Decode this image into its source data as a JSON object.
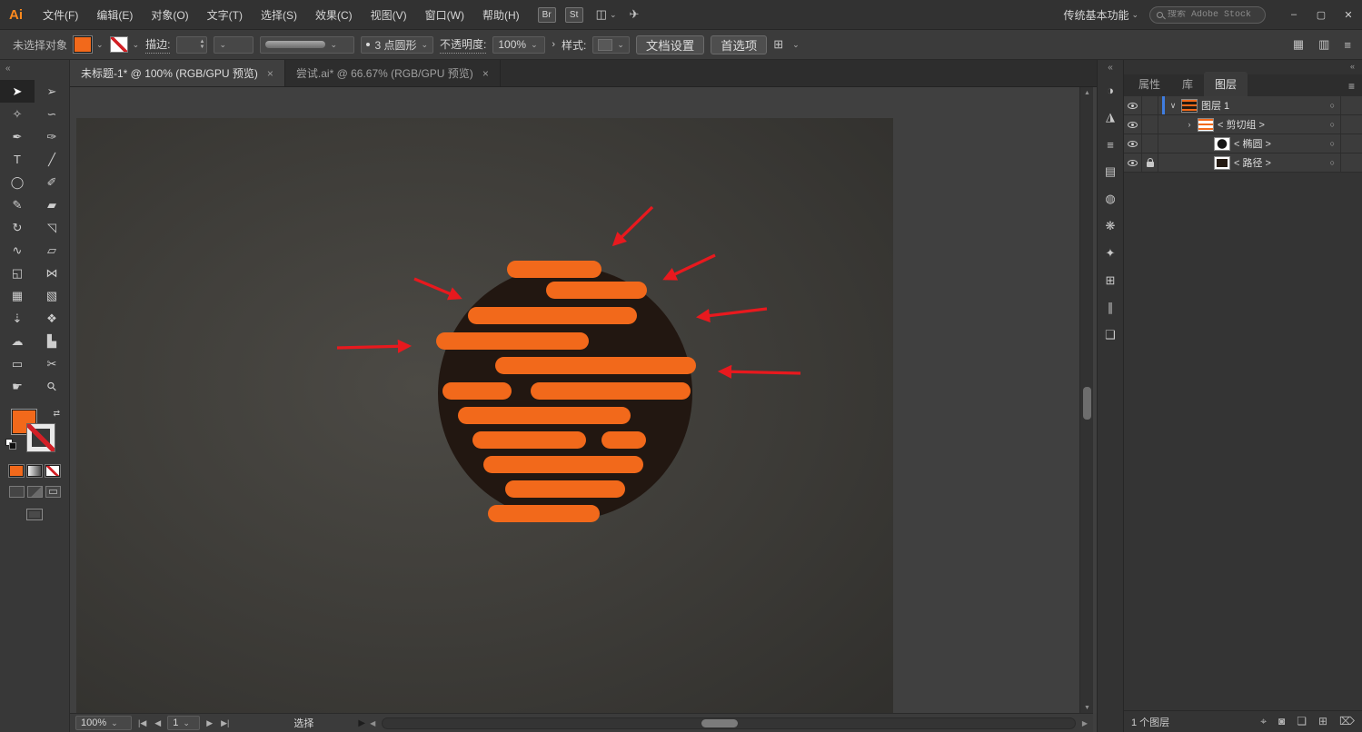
{
  "colors": {
    "accent": "#ff8a1e",
    "stripe": "#f2691b",
    "arrow": "#e8191e",
    "circleFill": "#221711",
    "layerblue": "#3f7de0"
  },
  "titlebar": {
    "logo": "Ai",
    "menus": [
      "文件(F)",
      "编辑(E)",
      "对象(O)",
      "文字(T)",
      "选择(S)",
      "效果(C)",
      "视图(V)",
      "窗口(W)",
      "帮助(H)"
    ],
    "bridge_button": "Br",
    "stock_button": "St",
    "layout_icon": "◫",
    "share_icon": "✈",
    "workspace_switcher": "传统基本功能",
    "search_placeholder": "搜索 Adobe Stock",
    "minimize": "–",
    "maximize": "▢",
    "close": "✕"
  },
  "controlbar": {
    "no_selection_label": "未选择对象",
    "stroke_label": "描边:",
    "brush_name": "3 点圆形",
    "opacity_label": "不透明度:",
    "opacity_value": "100%",
    "opacity_disclose": "›",
    "style_label": "样式:",
    "document_setup_button": "文档设置",
    "preferences_button": "首选项",
    "align_icon": "⊞",
    "arrange_icon": "▦",
    "docs_icon": "▥",
    "menu_icon": "≡"
  },
  "doc_tabs": [
    {
      "title": "未标题-1* @ 100% (RGB/GPU 预览)",
      "close": "×",
      "state": "active"
    },
    {
      "title": "尝试.ai* @ 66.67% (RGB/GPU 预览)",
      "close": "×",
      "state": "inactive"
    }
  ],
  "tools": [
    {
      "name": "selection-tool",
      "glyph": "➤",
      "state": "active"
    },
    {
      "name": "direct-selection-tool",
      "glyph": "➢",
      "state": "normal"
    },
    {
      "name": "magic-wand-tool",
      "glyph": "✧",
      "state": "normal"
    },
    {
      "name": "lasso-tool",
      "glyph": "∽",
      "state": "normal"
    },
    {
      "name": "pen-tool",
      "glyph": "✒",
      "state": "normal"
    },
    {
      "name": "curvature-tool",
      "glyph": "✑",
      "state": "normal"
    },
    {
      "name": "type-tool",
      "glyph": "T",
      "state": "normal"
    },
    {
      "name": "line-segment-tool",
      "glyph": "╱",
      "state": "normal"
    },
    {
      "name": "ellipse-tool",
      "glyph": "◯",
      "state": "normal"
    },
    {
      "name": "paintbrush-tool",
      "glyph": "✐",
      "state": "normal"
    },
    {
      "name": "shaper-tool",
      "glyph": "✎",
      "state": "normal"
    },
    {
      "name": "eraser-tool",
      "glyph": "▰",
      "state": "normal"
    },
    {
      "name": "rotate-tool",
      "glyph": "↻",
      "state": "normal"
    },
    {
      "name": "scale-tool",
      "glyph": "◹",
      "state": "normal"
    },
    {
      "name": "width-tool",
      "glyph": "∿",
      "state": "normal"
    },
    {
      "name": "free-transform-tool",
      "glyph": "▱",
      "state": "normal"
    },
    {
      "name": "shape-builder-tool",
      "glyph": "◱",
      "state": "normal"
    },
    {
      "name": "perspective-grid-tool",
      "glyph": "⋈",
      "state": "normal"
    },
    {
      "name": "mesh-tool",
      "glyph": "▦",
      "state": "normal"
    },
    {
      "name": "gradient-tool",
      "glyph": "▧",
      "state": "normal"
    },
    {
      "name": "eyedropper-tool",
      "glyph": "⇣",
      "state": "normal"
    },
    {
      "name": "blend-tool",
      "glyph": "❖",
      "state": "normal"
    },
    {
      "name": "symbol-sprayer-tool",
      "glyph": "☁",
      "state": "normal"
    },
    {
      "name": "column-graph-tool",
      "glyph": "▙",
      "state": "normal"
    },
    {
      "name": "artboard-tool",
      "glyph": "▭",
      "state": "normal"
    },
    {
      "name": "slice-tool",
      "glyph": "✂",
      "state": "normal"
    },
    {
      "name": "hand-tool",
      "glyph": "☛",
      "state": "normal"
    },
    {
      "name": "zoom-tool",
      "glyph": "⚲",
      "state": "normal"
    }
  ],
  "panel_strip": [
    {
      "name": "color-panel-icon",
      "glyph": "◑"
    },
    {
      "name": "color-guide-panel-icon",
      "glyph": "◮"
    },
    {
      "name": "stroke-panel-icon",
      "glyph": "≡"
    },
    {
      "name": "gradient-panel-icon",
      "glyph": "▤"
    },
    {
      "name": "transparency-panel-icon",
      "glyph": "◍"
    },
    {
      "name": "brushes-panel-icon",
      "glyph": "❋"
    },
    {
      "name": "symbols-panel-icon",
      "glyph": "✦"
    },
    {
      "name": "transform-panel-icon",
      "glyph": "⊞"
    },
    {
      "name": "align-panel-icon",
      "glyph": "∥"
    },
    {
      "name": "pathfinder-panel-icon",
      "glyph": "❑"
    }
  ],
  "dock": {
    "collapse_icon": "«",
    "panel_menu_icon": "≡",
    "tabs": [
      {
        "label": "属性",
        "state": "inactive"
      },
      {
        "label": "库",
        "state": "inactive"
      },
      {
        "label": "图层",
        "state": "active"
      }
    ],
    "layers": [
      {
        "name": "图层 1",
        "disclosure": "∨",
        "ind": "a",
        "thumb": "artwork",
        "locked": "false",
        "selected": "true"
      },
      {
        "name": "< 剪切组 >",
        "disclosure": "›",
        "ind": "b",
        "thumb": "clipgroup",
        "locked": "false",
        "selected": "false"
      },
      {
        "name": "< 椭圆 >",
        "disclosure": "",
        "ind": "c",
        "thumb": "ellipse",
        "locked": "false",
        "selected": "false"
      },
      {
        "name": "< 路径 >",
        "disclosure": "",
        "ind": "c",
        "thumb": "path",
        "locked": "true",
        "selected": "false"
      }
    ],
    "target_glyph": "○",
    "footer_count": "1 个图层",
    "footer_icons": [
      {
        "name": "locate-object-icon",
        "glyph": "⌖"
      },
      {
        "name": "make-clip-mask-icon",
        "glyph": "◙"
      },
      {
        "name": "new-sublayer-icon",
        "glyph": "❏"
      },
      {
        "name": "new-layer-icon",
        "glyph": "⊞"
      },
      {
        "name": "delete-selection-icon",
        "glyph": "⌦"
      }
    ]
  },
  "toolbar_collapse_icon": "«",
  "statusbar": {
    "zoom": "100%",
    "first": "|◀",
    "prev": "◀",
    "artboard": "1",
    "next": "▶",
    "last": "▶|",
    "tool_status": "选择",
    "popup_arrow": "▶",
    "scroll_left": "◀",
    "scroll_right": "▶",
    "scroll_up": "▲",
    "scroll_down": "▼"
  }
}
